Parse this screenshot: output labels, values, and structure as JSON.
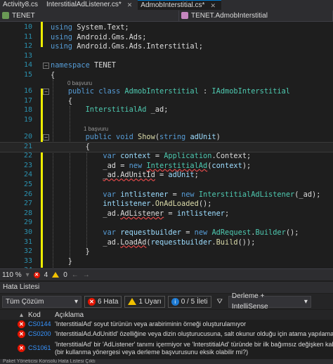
{
  "tabs": [
    {
      "label": "Activity8.cs",
      "close": ""
    },
    {
      "label": "InterstitialAdListener.cs*",
      "close": "✕"
    },
    {
      "label": "AdmobInterstitial.cs*",
      "close": "✕"
    }
  ],
  "nav": {
    "left": "TENET",
    "right": "TENET.AdmobInterstitial"
  },
  "code": {
    "l10": {
      "n": "10"
    },
    "l11": {
      "n": "11"
    },
    "l12": {
      "n": "12"
    },
    "l13": {
      "n": "13"
    },
    "l14": {
      "n": "14"
    },
    "l15": {
      "n": "15"
    },
    "l16": {
      "n": "16"
    },
    "l17": {
      "n": "17"
    },
    "l18": {
      "n": "18"
    },
    "l19": {
      "n": "19"
    },
    "l20": {
      "n": "20"
    },
    "l21": {
      "n": "21"
    },
    "l22": {
      "n": "22"
    },
    "l23": {
      "n": "23"
    },
    "l24": {
      "n": "24"
    },
    "l25": {
      "n": "25"
    },
    "l26": {
      "n": "26"
    },
    "l27": {
      "n": "27"
    },
    "l28": {
      "n": "28"
    },
    "l29": {
      "n": "29"
    },
    "l30": {
      "n": "30"
    },
    "l31": {
      "n": "31"
    },
    "l32": {
      "n": "32"
    },
    "l33": {
      "n": "33"
    },
    "l34": {
      "n": "34"
    },
    "ref1": "0 başvuru",
    "ref2": "1 başvuru"
  },
  "status": {
    "zoom": "110 %",
    "errors": "4",
    "warnings": "0"
  },
  "error_list": {
    "title": "Hata Listesi",
    "scope": "Tüm Çözüm",
    "errors_btn": "6 Hata",
    "warnings_btn": "1 Uyarı",
    "messages_btn": "0 / 5 İleti",
    "build_filter": "Derleme + IntelliSense",
    "col_code": "Kod",
    "col_desc": "Açıklama",
    "rows": [
      {
        "code": "CS0144",
        "desc": "'InterstitialAd' soyut türünün veya arabiriminin örneği oluşturulamıyor"
      },
      {
        "code": "CS0200",
        "desc": "'InterstitialAd.AdUnitId' özelliğine veya dizin oluşturucusuna, salt okunur olduğu için atama yapılamaz"
      },
      {
        "code": "CS1061",
        "desc": "'InterstitialAd' bir 'AdListener' tanımı içermiyor ve 'InterstitialAd' türünde bir ilk bağımsız değişken kabul\n(bir kullanma yönergesi veya derleme başvurusunu eksik olabilir mi?)"
      }
    ]
  },
  "bottom_tabs": "Paket Yöneticisi Konsolu   Hata Listesi   Çıktı",
  "colors": {
    "accent": "#007acc",
    "error": "#e51400",
    "warning": "#f0c000",
    "info": "#1e7ad2"
  }
}
